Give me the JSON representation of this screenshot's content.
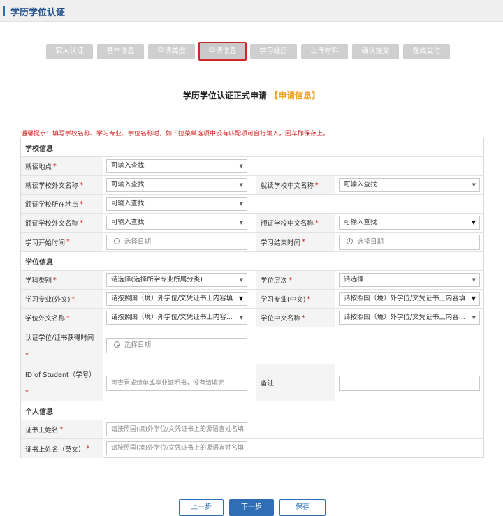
{
  "page": {
    "title": "学历学位认证"
  },
  "steps": [
    "实人认证",
    "基本信息",
    "申请类型",
    "申请信息",
    "学习经历",
    "上传材料",
    "确认提交",
    "在线支付"
  ],
  "form_title": {
    "main": "学历学位认证正式申请",
    "highlight": "【申请信息】"
  },
  "tip": "温馨提示：填写学校名称、学习专业、学位名称时，如下拉菜单选项中没有匹配项可自行输入，回车即保存上。",
  "sections": {
    "school": "学校信息",
    "degree": "学位信息",
    "personal": "个人信息"
  },
  "fields": {
    "study_location": {
      "label": "就读地点",
      "value": "可输入查找"
    },
    "school_foreign_name": {
      "label": "就读学校外文名称",
      "value": "可输入查找"
    },
    "school_cn_name": {
      "label": "就读学校中文名称",
      "value": "可输入查找"
    },
    "issuer_location": {
      "label": "颁证学校所在地点",
      "value": "可输入查找"
    },
    "issuer_foreign_name": {
      "label": "颁证学校外文名称",
      "value": "可输入查找"
    },
    "issuer_cn_name": {
      "label": "颁证学校中文名称",
      "value": "可输入查找"
    },
    "study_start": {
      "label": "学习开始时间",
      "placeholder": "选择日期"
    },
    "study_end": {
      "label": "学习结束时间",
      "placeholder": "选择日期"
    },
    "subject_category": {
      "label": "学科类别",
      "value": "请选择(选择所学专业所属分类)"
    },
    "degree_level": {
      "label": "学位层次",
      "value": "请选择"
    },
    "major_foreign": {
      "label": "学习专业(外文)",
      "value": "请按照国（境）外学位/文凭证书上内容填"
    },
    "major_cn": {
      "label": "学习专业(中文)",
      "value": "请按照国（境）外学位/文凭证书上内容填"
    },
    "degree_foreign_name": {
      "label": "学位外文名称",
      "value": "请按照国（境）外学位/文凭证书上内容..."
    },
    "degree_cn_name": {
      "label": "学位中文名称",
      "value": "请按照国（境）外学位/文凭证书上内容..."
    },
    "degree_obtained_time": {
      "label": "认证学位/证书获得时间",
      "placeholder": "选择日期"
    },
    "student_id": {
      "label": "ID of Student（学号）",
      "placeholder": "可查看成绩单或毕业证明书，没有请填无"
    },
    "remarks": {
      "label": "备注",
      "value": ""
    },
    "cert_surname": {
      "label": "证书上姓名",
      "placeholder": "请按照国(境)外学位/文凭证书上的源语言姓名填"
    },
    "cert_name_en": {
      "label": "证书上姓名（英文）",
      "placeholder": "请按照国(境)外学位/文凭证书上的源语言姓名填"
    }
  },
  "required_mark": "*",
  "buttons": {
    "prev": "上一步",
    "next": "下一步",
    "save": "保存"
  },
  "colors": {
    "accent": "#2f6db5",
    "highlight": "#f0a020",
    "required": "#d01818",
    "active_step_border": "#d02828",
    "step_bg": "#cfcfcf"
  }
}
